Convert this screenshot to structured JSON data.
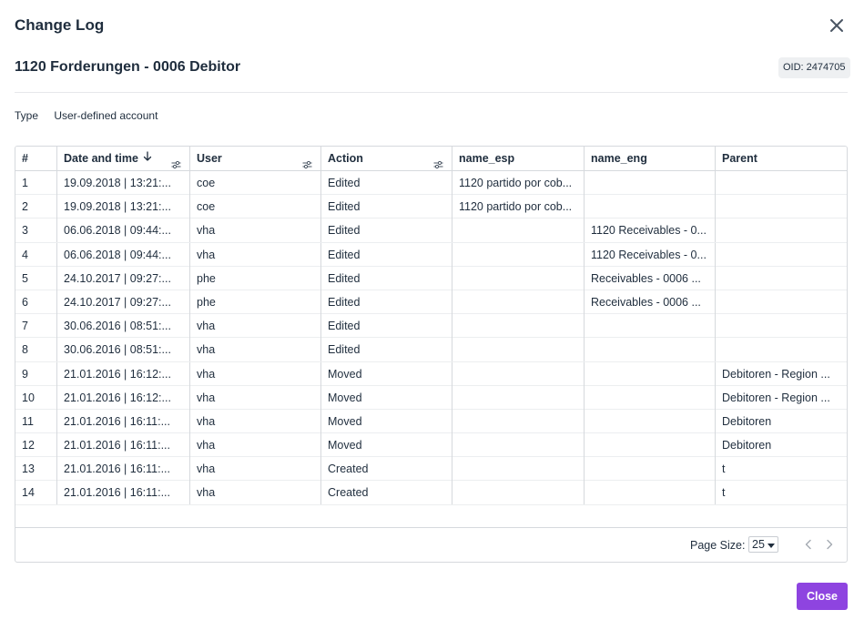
{
  "dialog": {
    "title": "Change Log",
    "subtitle": "1120 Forderungen - 0006 Debitor",
    "oid": "OID: 2474705",
    "type_label": "Type",
    "type_value": "User-defined account",
    "close_label": "Close"
  },
  "table": {
    "columns": [
      "#",
      "Date and time",
      "User",
      "Action",
      "name_esp",
      "name_eng",
      "Parent"
    ],
    "sorted_column": "Date and time",
    "sort_direction": "descending",
    "rows": [
      {
        "n": "1",
        "date": "19.09.2018 | 13:21:...",
        "user": "coe",
        "action": "Edited",
        "name_esp": "1120 partido por cob...",
        "name_eng": "",
        "parent": ""
      },
      {
        "n": "2",
        "date": "19.09.2018 | 13:21:...",
        "user": "coe",
        "action": "Edited",
        "name_esp": "1120 partido por cob...",
        "name_eng": "",
        "parent": ""
      },
      {
        "n": "3",
        "date": "06.06.2018 | 09:44:...",
        "user": "vha",
        "action": "Edited",
        "name_esp": "",
        "name_eng": "1120 Receivables - 0...",
        "parent": ""
      },
      {
        "n": "4",
        "date": "06.06.2018 | 09:44:...",
        "user": "vha",
        "action": "Edited",
        "name_esp": "",
        "name_eng": "1120 Receivables - 0...",
        "parent": ""
      },
      {
        "n": "5",
        "date": "24.10.2017 | 09:27:...",
        "user": "phe",
        "action": "Edited",
        "name_esp": "",
        "name_eng": "Receivables - 0006 ...",
        "parent": ""
      },
      {
        "n": "6",
        "date": "24.10.2017 | 09:27:...",
        "user": "phe",
        "action": "Edited",
        "name_esp": "",
        "name_eng": "Receivables - 0006 ...",
        "parent": ""
      },
      {
        "n": "7",
        "date": "30.06.2016 | 08:51:...",
        "user": "vha",
        "action": "Edited",
        "name_esp": "",
        "name_eng": "",
        "parent": ""
      },
      {
        "n": "8",
        "date": "30.06.2016 | 08:51:...",
        "user": "vha",
        "action": "Edited",
        "name_esp": "",
        "name_eng": "",
        "parent": ""
      },
      {
        "n": "9",
        "date": "21.01.2016 | 16:12:...",
        "user": "vha",
        "action": "Moved",
        "name_esp": "",
        "name_eng": "",
        "parent": "Debitoren - Region ..."
      },
      {
        "n": "10",
        "date": "21.01.2016 | 16:12:...",
        "user": "vha",
        "action": "Moved",
        "name_esp": "",
        "name_eng": "",
        "parent": "Debitoren - Region ..."
      },
      {
        "n": "11",
        "date": "21.01.2016 | 16:11:...",
        "user": "vha",
        "action": "Moved",
        "name_esp": "",
        "name_eng": "",
        "parent": "Debitoren"
      },
      {
        "n": "12",
        "date": "21.01.2016 | 16:11:...",
        "user": "vha",
        "action": "Moved",
        "name_esp": "",
        "name_eng": "",
        "parent": "Debitoren"
      },
      {
        "n": "13",
        "date": "21.01.2016 | 16:11:...",
        "user": "vha",
        "action": "Created",
        "name_esp": "",
        "name_eng": "",
        "parent": "t"
      },
      {
        "n": "14",
        "date": "21.01.2016 | 16:11:...",
        "user": "vha",
        "action": "Created",
        "name_esp": "",
        "name_eng": "",
        "parent": "t"
      }
    ]
  },
  "pager": {
    "page_size_label": "Page Size:",
    "page_size_value": "25"
  },
  "icons": {
    "close": "close-x-icon",
    "sort": "arrow-down-icon",
    "filter": "sliders-icon",
    "caret": "caret-down-icon",
    "prev": "chevron-left-icon",
    "next": "chevron-right-icon"
  },
  "colors": {
    "accent": "#8e44e0",
    "text": "#1f2d3d",
    "border": "#d6d9dd"
  }
}
